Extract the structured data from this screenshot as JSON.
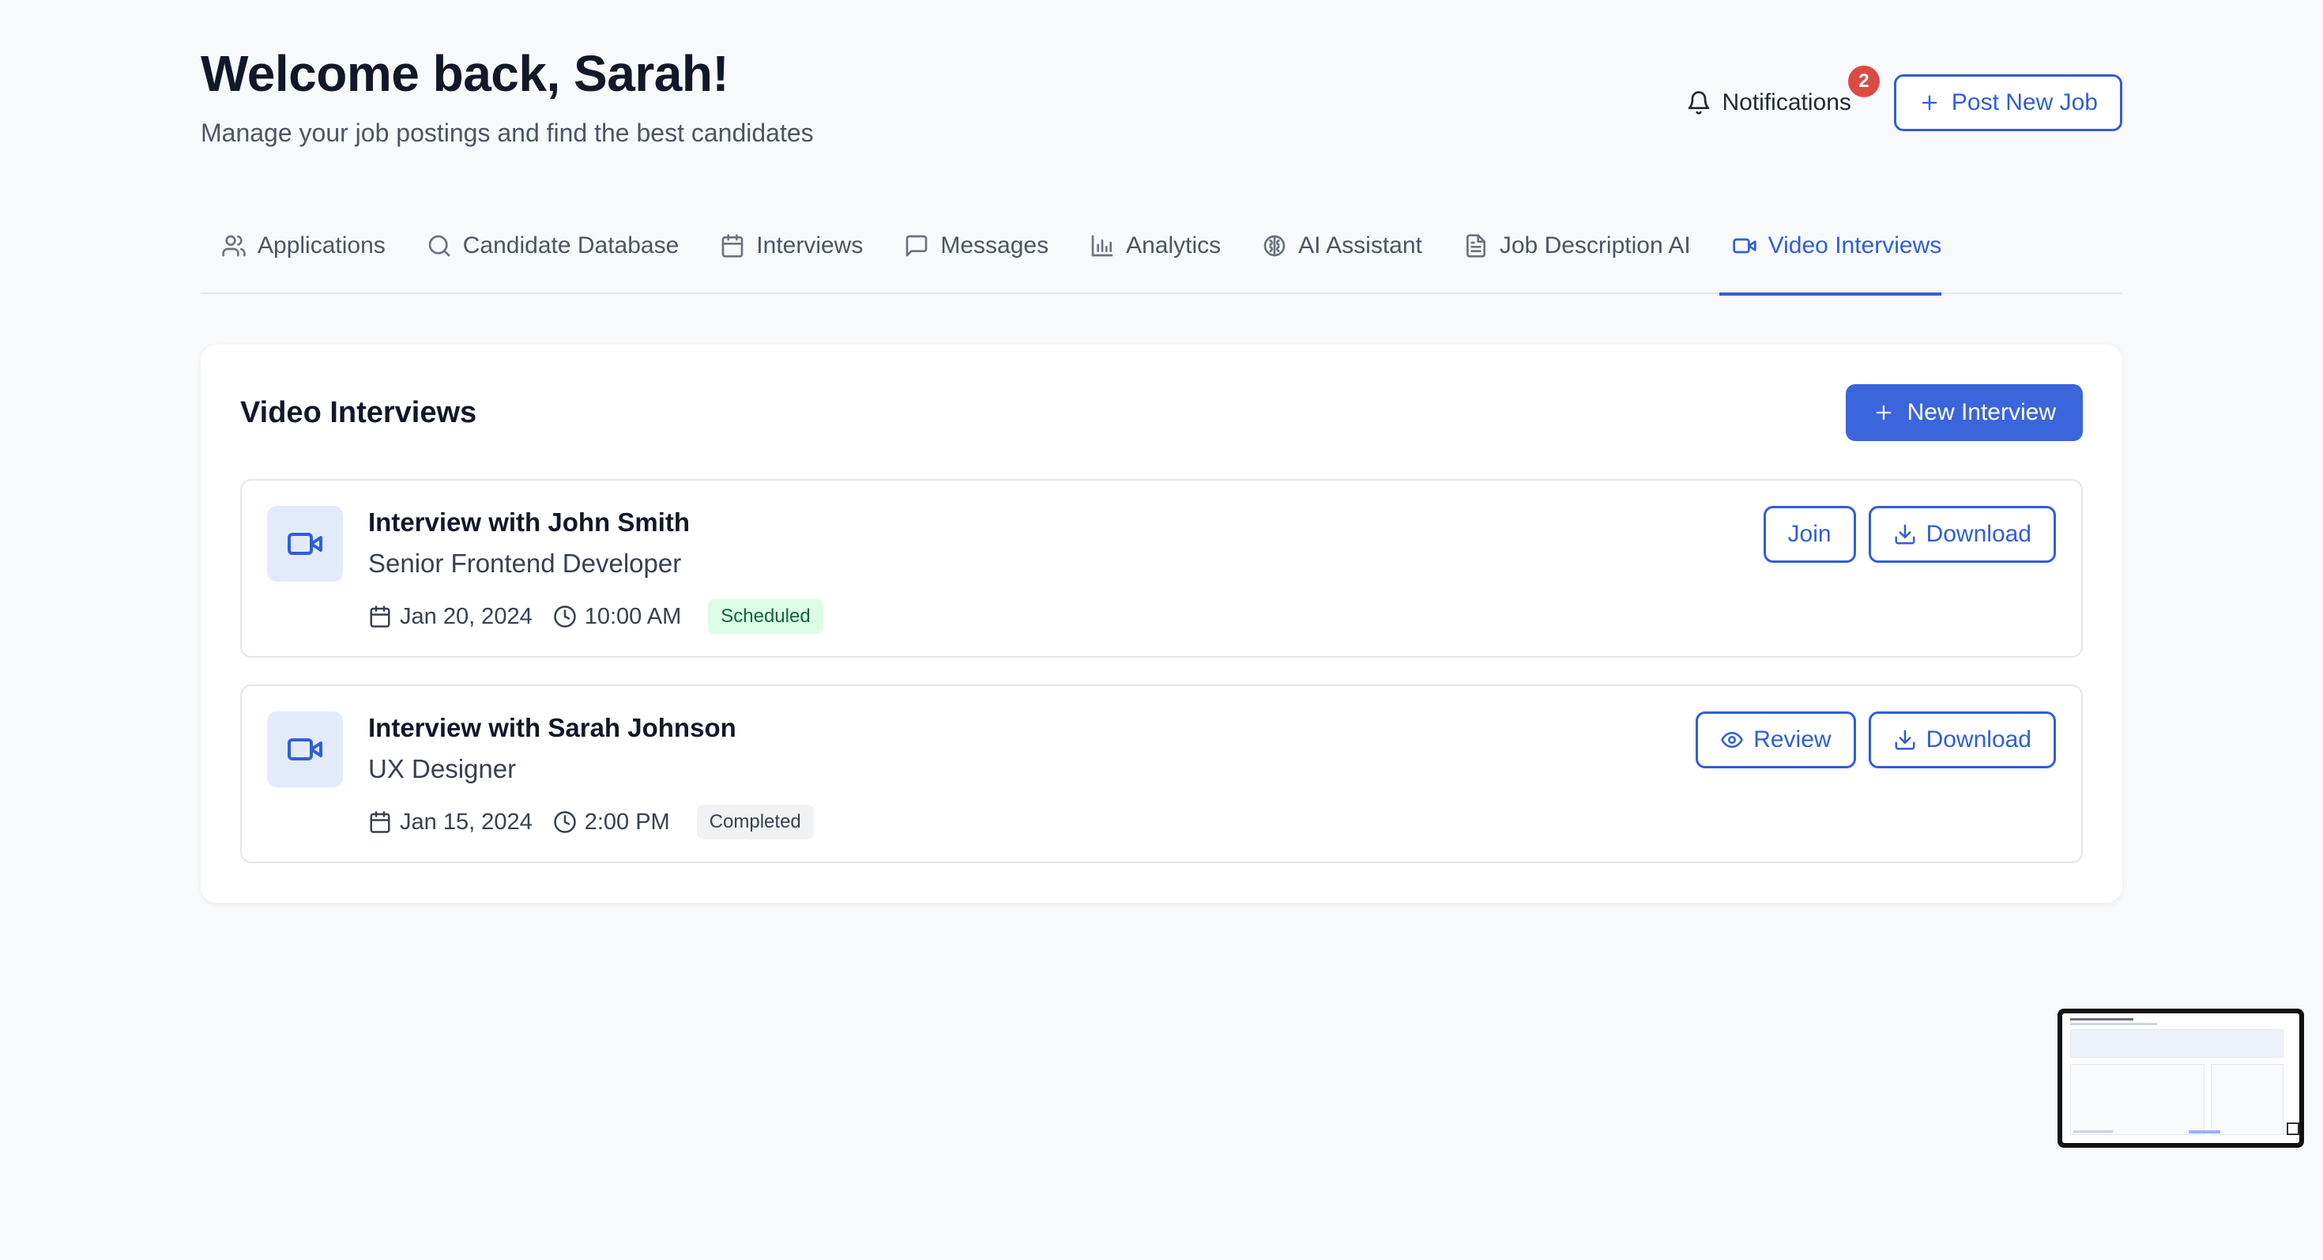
{
  "header": {
    "title": "Welcome back, Sarah!",
    "subtitle": "Manage your job postings and find the best candidates",
    "notifications_label": "Notifications",
    "notifications_count": "2",
    "post_job_label": "Post New Job"
  },
  "tabs": [
    {
      "label": "Applications",
      "icon": "users-icon"
    },
    {
      "label": "Candidate Database",
      "icon": "search-icon"
    },
    {
      "label": "Interviews",
      "icon": "calendar-icon"
    },
    {
      "label": "Messages",
      "icon": "message-icon"
    },
    {
      "label": "Analytics",
      "icon": "bar-chart-icon"
    },
    {
      "label": "AI Assistant",
      "icon": "brain-icon"
    },
    {
      "label": "Job Description AI",
      "icon": "document-icon"
    },
    {
      "label": "Video Interviews",
      "icon": "video-icon",
      "active": true
    }
  ],
  "card": {
    "title": "Video Interviews",
    "new_interview_label": "New Interview"
  },
  "interviews": [
    {
      "title": "Interview with John Smith",
      "role": "Senior Frontend Developer",
      "date": "Jan 20, 2024",
      "time": "10:00 AM",
      "status": "Scheduled",
      "primary_action": "Join",
      "secondary_action": "Download"
    },
    {
      "title": "Interview with Sarah Johnson",
      "role": "UX Designer",
      "date": "Jan 15, 2024",
      "time": "2:00 PM",
      "status": "Completed",
      "primary_action": "Review",
      "secondary_action": "Download"
    }
  ],
  "colors": {
    "primary": "#2f5fd7",
    "badge": "#dc4a45",
    "scheduled_bg": "#dcfce7",
    "completed_bg": "#f1f2f4"
  }
}
